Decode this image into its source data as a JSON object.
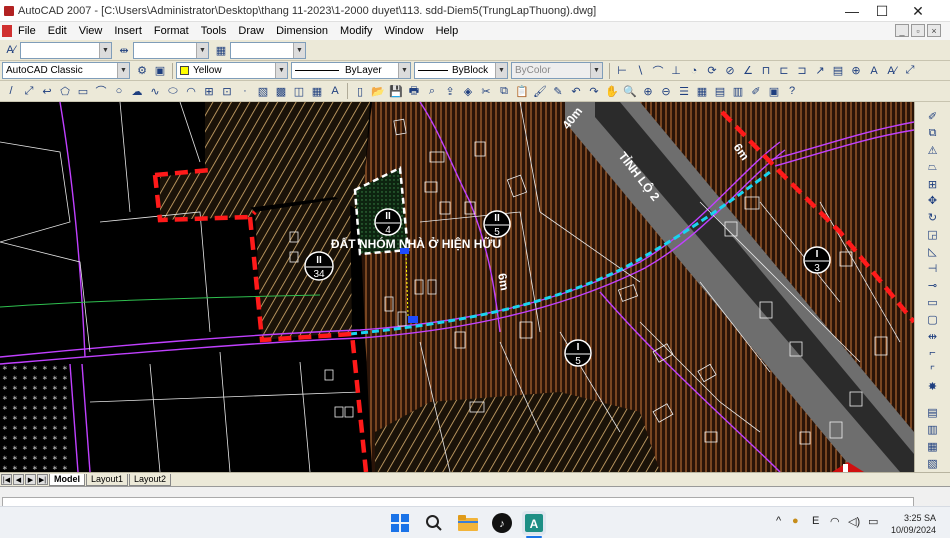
{
  "window": {
    "title": "AutoCAD 2007 - [C:\\Users\\Administrator\\Desktop\\thang 11-2023\\1-2000 duyet\\113. sdd-Diem5(TrungLapThuong).dwg]",
    "minimize": "—",
    "maximize": "☐",
    "close": "✕"
  },
  "menu": [
    "File",
    "Edit",
    "View",
    "Insert",
    "Format",
    "Tools",
    "Draw",
    "Dimension",
    "Modify",
    "Window",
    "Help"
  ],
  "toolbar": {
    "workspace": "AutoCAD Classic",
    "layer_color": "Yellow",
    "linetype": "ByLayer",
    "lineweight": "ByBlock",
    "plotstyle": "ByColor"
  },
  "drawing": {
    "main_label": "ĐẤT NHÓM NHÀ Ở HIỆN HỮU",
    "road_label_1": "TỈNH LỘ 2",
    "road_width_1": "40m",
    "road_width_2": "6m",
    "road_width_3": "6m",
    "lots": [
      {
        "top": "II",
        "bottom": "4"
      },
      {
        "top": "II",
        "bottom": "5"
      },
      {
        "top": "II",
        "bottom": "34"
      },
      {
        "top": "I",
        "bottom": "3"
      },
      {
        "top": "I",
        "bottom": "5"
      }
    ]
  },
  "tabs": [
    "Model",
    "Layout1",
    "Layout2"
  ],
  "taskbar": {
    "time": "3:25 SA",
    "date": "10/09/2024",
    "icons": [
      "windows-icon",
      "search-icon",
      "file-explorer-icon",
      "tiktok-icon",
      "autocad-icon"
    ]
  },
  "colors": {
    "accent_red": "#ff1a1a",
    "cyan_line": "#19d4f0",
    "hatch_brown": "#8a5a2e",
    "magenta": "#c040ff"
  }
}
